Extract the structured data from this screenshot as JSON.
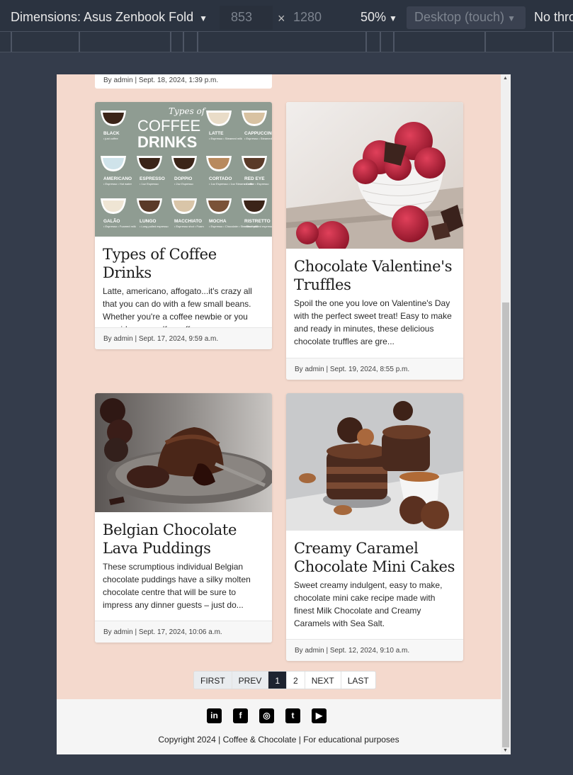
{
  "devtools": {
    "dimensions": "Dimensions: Asus Zenbook Fold",
    "width": "853",
    "times": "×",
    "height": "1280",
    "zoom": "50%",
    "device_type": "Desktop (touch)",
    "throttle": "No thro",
    "caret": "▼"
  },
  "top_card_meta": "By admin | Sept. 18, 2024, 1:39 p.m.",
  "cards": [
    {
      "title": "Types of Coffee Drinks",
      "excerpt": "Latte, americano, affogato...it's crazy all that you can do with a few small beans. Whether you're a coffee newbie or you consider yourself a coffee co...",
      "meta": "By admin | Sept. 17, 2024, 9:59 a.m.",
      "image": {
        "script_title": "Types of",
        "title_line1": "COFFEE",
        "title_line2": "DRINKS",
        "drinks": [
          {
            "name": "BLACK",
            "note": "• just coffee"
          },
          {
            "name": "LATTE",
            "note": "• Espresso • Steamed milk"
          },
          {
            "name": "CAPPUCCINO",
            "note": "• Espresso • Steamed milk • Foam"
          },
          {
            "name": "AMERICANO",
            "note": "• Espresso • Hot water"
          },
          {
            "name": "ESPRESSO",
            "note": "• 1oz Espresso"
          },
          {
            "name": "DOPPIO",
            "note": "• 2oz Espresso"
          },
          {
            "name": "CORTADO",
            "note": "• 1oz Espresso • 1oz Steamed milk"
          },
          {
            "name": "RED EYE",
            "note": "• Coffee • Espresso"
          },
          {
            "name": "GALÃO",
            "note": "• Espresso • Foamed milk"
          },
          {
            "name": "LUNGO",
            "note": "• Long pulled espresso"
          },
          {
            "name": "MACCHIATO",
            "note": "• Espresso shot • Foam"
          },
          {
            "name": "MOCHA",
            "note": "• Espresso • Chocolate • Steamed milk"
          },
          {
            "name": "RISTRETTO",
            "note": "• Short pulled espresso"
          }
        ]
      }
    },
    {
      "title": "Chocolate Valentine's Truffles",
      "excerpt": "Spoil the one you love on Valentine's Day with the perfect sweet treat! Easy to make and ready in minutes, these delicious chocolate truffles are gre...",
      "meta": "By admin | Sept. 19, 2024, 8:55 p.m."
    },
    {
      "title": "Belgian Chocolate Lava Puddings",
      "excerpt": "These scrumptious individual Belgian chocolate puddings have a silky molten chocolate centre that will be sure to impress any dinner guests – just do...",
      "meta": "By admin | Sept. 17, 2024, 10:06 a.m."
    },
    {
      "title": "Creamy Caramel Chocolate Mini Cakes",
      "excerpt": "Sweet creamy indulgent, easy to make, chocolate mini cake recipe made with finest Milk Chocolate and Creamy Caramels with Sea Salt.",
      "meta": "By admin | Sept. 12, 2024, 9:10 a.m."
    }
  ],
  "pagination": {
    "first": "FIRST",
    "prev": "PREV",
    "page1": "1",
    "page2": "2",
    "next": "NEXT",
    "last": "LAST"
  },
  "footer": {
    "socials": [
      {
        "icon": "linkedin-icon",
        "glyph": "in"
      },
      {
        "icon": "facebook-icon",
        "glyph": "f"
      },
      {
        "icon": "instagram-icon",
        "glyph": "◎"
      },
      {
        "icon": "twitter-icon",
        "glyph": "t"
      },
      {
        "icon": "youtube-icon",
        "glyph": "▶"
      }
    ],
    "copyright": "Copyright 2024 | Coffee & Chocolate | For educational purposes"
  },
  "colors": {
    "page_bg": "#f4d9cd",
    "coffee_chart_bg": "#8f9c92",
    "pager_active": "#1e2430"
  }
}
